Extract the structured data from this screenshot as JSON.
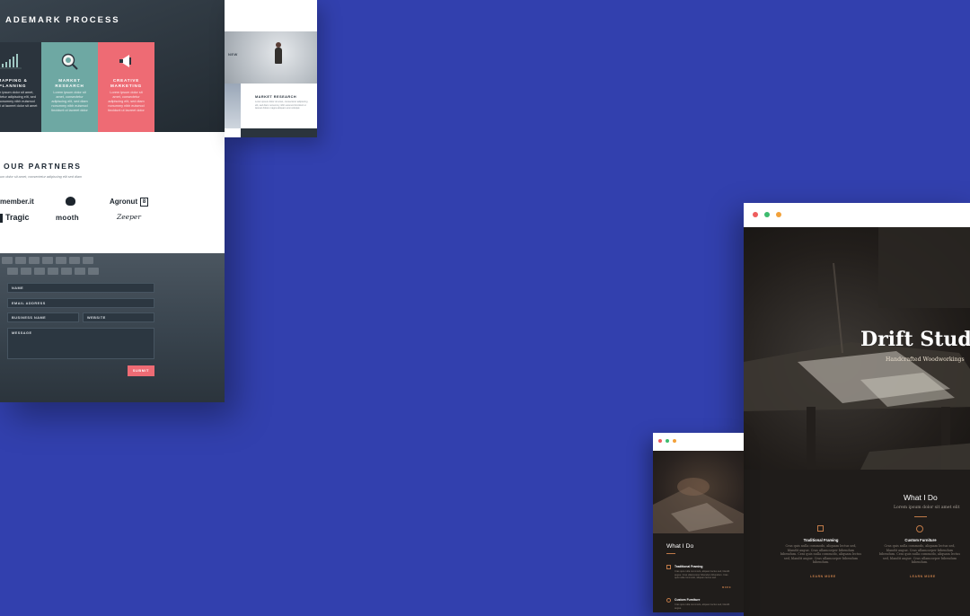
{
  "left_mockup": {
    "process_title": "ADEMARK PROCESS",
    "cards": [
      {
        "title": "MAPPING &\nPLANNING",
        "body": "Lorem ipsum dolor sit amet, consectetur adipiscing elit, sed diam nonummy nibh euismod tincidunt ut laoreet dolor sit amet",
        "icon": "bar-chart-icon",
        "color": "#2b343d"
      },
      {
        "title": "MARKET\nRESEARCH",
        "body": "Lorem ipsum dolor sit amet, consectetur adipiscing elit, sed diam nonummy nibh euismod tincidunt ut laoreet dolor",
        "icon": "magnifier-icon",
        "color": "#6ea8a3"
      },
      {
        "title": "CREATIVE\nMARKETING",
        "body": "Lorem ipsum dolor sit amet, consectetur adipiscing elit, sed diam nonummy nibh euismod tincidunt ut laoreet dolor",
        "icon": "megaphone-icon",
        "color": "#ee6b74"
      }
    ],
    "partners_title": "OUR PARTNERS",
    "partners_subtitle": "um dolor sit amet, consectetur adipiscing elit sed diam",
    "partner_logos": [
      "member.it",
      "Agronut",
      "Tragic",
      "mooth",
      "Zeeper"
    ],
    "form": {
      "name": "NAME",
      "email": "EMAIL ADDRESS",
      "business": "BUSINESS NAME",
      "website": "WEBSITE",
      "message": "MESSAGE",
      "submit": "SUBMIT"
    }
  },
  "top_mockup": {
    "caption": "NEW",
    "section_title": "MARKET RESEARCH",
    "section_body": "Lorem ipsum dolor sit amet, consectetur adipiscing elit, sed diam nonummy nibh euismod tincidunt ut laoreet dolore magna aliquam erat volutpat."
  },
  "right_browser": {
    "hero_title": "Drift Studio",
    "hero_subtitle": "Handcrafted Woodworkings",
    "section_title": "What I Do",
    "section_subtitle": "Lorem ipsum dolor sit amet elit",
    "services": [
      {
        "title": "Traditional Framing",
        "icon": "square-icon",
        "body": "Cras quis nulla commodo, aliquam lectus sed, blandit augue. Cras ullamcorper bibendum bibendum. Cras quis nulla commodo, aliquam lectus sed, blandit augue. Cras ullamcorper bibendum bibendum.",
        "link": "LEARN MORE"
      },
      {
        "title": "Custom Furniture",
        "icon": "circle-icon",
        "body": "Cras quis nulla commodo, aliquam lectus sed, blandit augue. Cras ullamcorper bibendum bibendum. Cras quis nulla commodo, aliquam lectus sed, blandit augue. Cras ullamcorper bibendum bibendum.",
        "link": "LEARN MORE"
      }
    ],
    "window_dots": [
      "#ee5d5d",
      "#3dbb6e",
      "#f2a13a"
    ]
  },
  "small_browser": {
    "section_title": "What I Do",
    "services": [
      {
        "title": "Traditional Framing",
        "body": "Cras quis nulla commodo, aliquam lectus sed, blandit augue. Cras ullamcorper bibendum bibendum. Cras quis nulla commodo, aliquam lectus sed.",
        "link": "MORE"
      },
      {
        "title": "Custom Furniture",
        "body": "Cras quis nulla commodo, aliquam lectus sed, blandit augue.",
        "link": ""
      }
    ]
  },
  "colors": {
    "background": "#3240ae",
    "accent_coral": "#ee6b74",
    "accent_teal": "#6ea8a3",
    "accent_copper": "#c07a48"
  }
}
